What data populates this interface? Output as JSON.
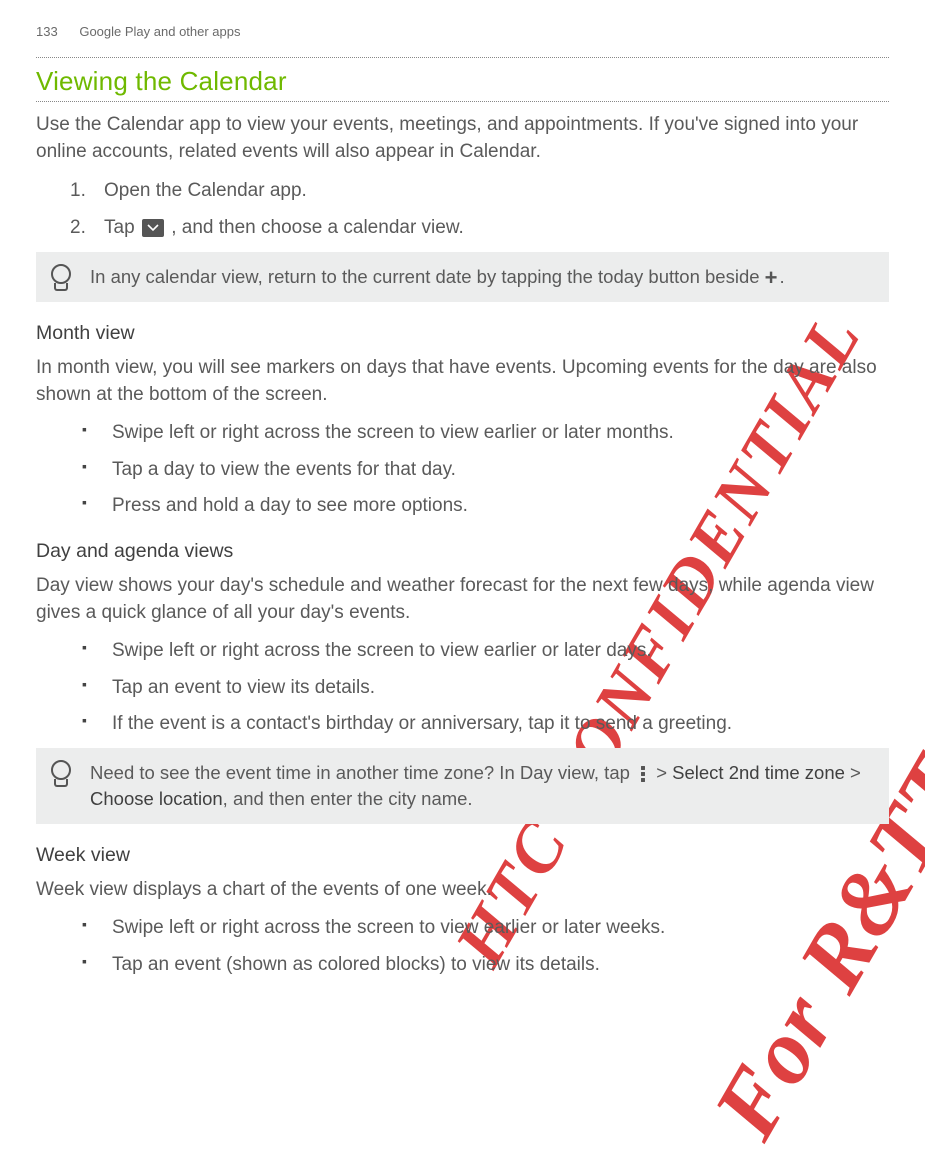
{
  "header": {
    "page_num": "133",
    "chapter": "Google Play and other apps"
  },
  "section_title": "Viewing the Calendar",
  "intro": "Use the Calendar app to view your events, meetings, and appointments. If you've signed into your online accounts, related events will also appear in Calendar.",
  "steps": [
    {
      "n": "1.",
      "text": "Open the Calendar app."
    },
    {
      "n": "2.",
      "text_a": "Tap ",
      "text_b": ", and then choose a calendar view."
    }
  ],
  "tip1": {
    "pre": "In any calendar view, return to the current date by tapping the today button beside ",
    "post": "."
  },
  "month": {
    "heading": "Month view",
    "intro": "In month view, you will see markers on days that have events. Upcoming events for the day are also shown at the bottom of the screen.",
    "bullets": [
      "Swipe left or right across the screen to view earlier or later months.",
      "Tap a day to view the events for that day.",
      "Press and hold a day to see more options."
    ]
  },
  "day": {
    "heading": "Day and agenda views",
    "intro": "Day view shows your day's schedule and weather forecast for the next few days, while agenda view gives a quick glance of all your day's events.",
    "bullets": [
      "Swipe left or right across the screen to view earlier or later days.",
      "Tap an event to view its details.",
      "If the event is a contact's birthday or anniversary, tap it to send a greeting."
    ]
  },
  "tip2": {
    "pre": "Need to see the event time in another time zone? In Day view, tap ",
    "mid1": " > ",
    "bold1": "Select 2nd time zone",
    "mid2": " > ",
    "bold2": "Choose location",
    "post": ", and then enter the city name."
  },
  "week": {
    "heading": "Week view",
    "intro": "Week view displays a chart of the events of one week.",
    "bullets": [
      "Swipe left or right across the screen to view earlier or later weeks.",
      "Tap an event (shown as colored blocks) to view its details."
    ]
  },
  "watermarks": {
    "w1": "HTC CONFIDENTIAL",
    "w2": "For R&TTE Certification only"
  }
}
